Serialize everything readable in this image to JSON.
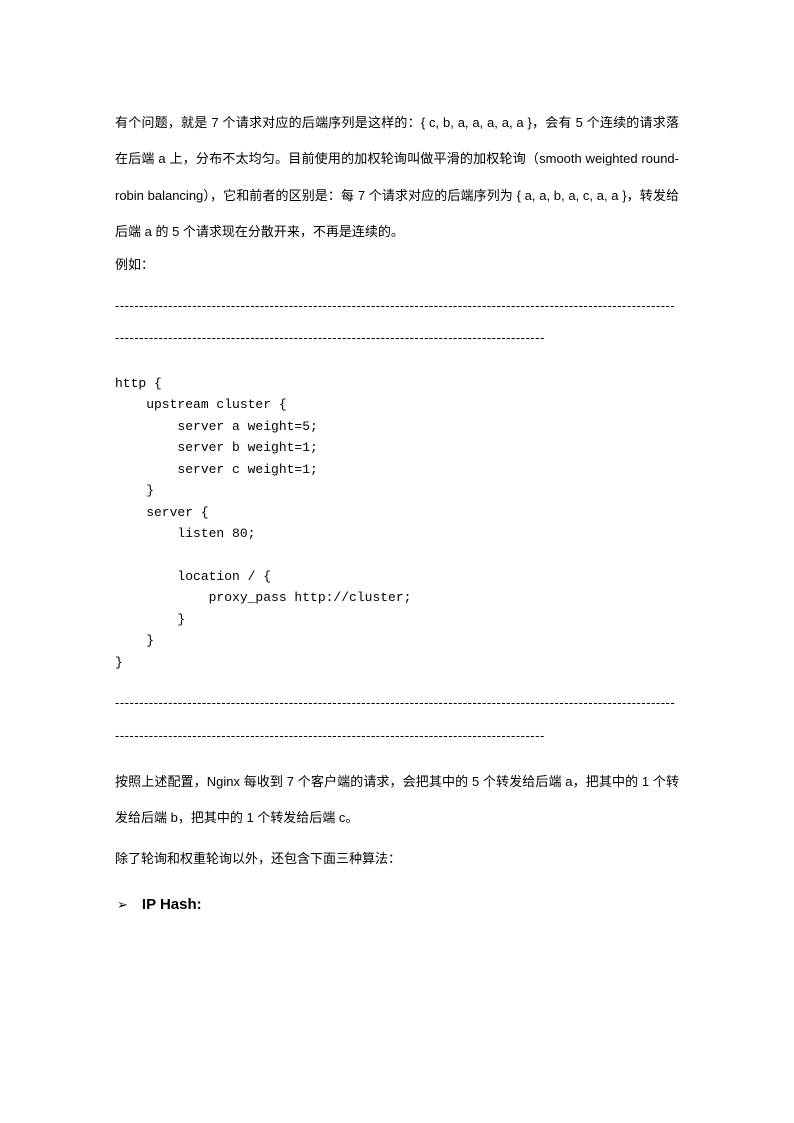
{
  "para1": "有个问题，就是 7 个请求对应的后端序列是这样的：{ c, b, a, a, a, a, a }，会有 5 个连续的请求落在后端 a 上，分布不太均匀。目前使用的加权轮询叫做平滑的加权轮询（smooth weighted round-robin balancing），它和前者的区别是：每 7 个请求对应的后端序列为 { a, a, b, a, c, a, a }，转发给后端 a 的 5 个请求现在分散开来，不再是连续的。",
  "exampleLabel": "例如：",
  "divider1": "-------------------------------------------------------------------------------------------------------------------------------------------------------------------------------------------------------------",
  "code": "http {\n    upstream cluster {\n        server a weight=5;\n        server b weight=1;\n        server c weight=1;\n    }\n    server {\n        listen 80;\n\n        location / {\n            proxy_pass http://cluster;\n        }\n    }\n}",
  "divider2": "-------------------------------------------------------------------------------------------------------------------------------------------------------------------------------------------------------------",
  "para2": "按照上述配置，Nginx 每收到 7 个客户端的请求，会把其中的 5 个转发给后端 a，把其中的 1 个转发给后端 b，把其中的 1 个转发给后端 c。",
  "para3": "除了轮询和权重轮询以外，还包含下面三种算法：",
  "bulletIcon": "➢",
  "bulletText": "IP Hash:"
}
